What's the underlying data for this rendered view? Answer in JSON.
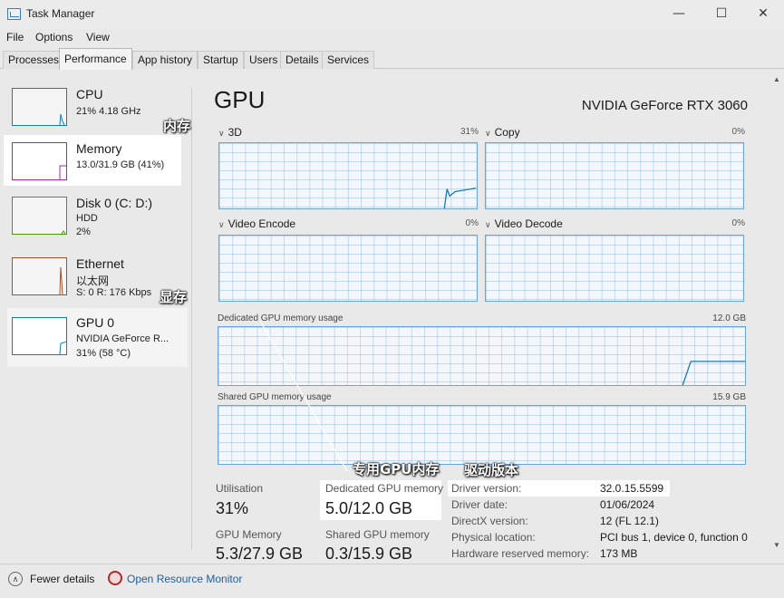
{
  "window": {
    "title": "Task Manager",
    "controls": {
      "minimize": "—",
      "maximize": "☐",
      "close": "✕"
    }
  },
  "menu": [
    "File",
    "Options",
    "View"
  ],
  "tabs": [
    "Processes",
    "Performance",
    "App history",
    "Startup",
    "Users",
    "Details",
    "Services"
  ],
  "active_tab": "Performance",
  "sidebar": {
    "items": [
      {
        "title": "CPU",
        "lines": [
          "21% 4.18 GHz"
        ],
        "color": "#1779ba",
        "icon": "cpu-graph"
      },
      {
        "title": "Memory",
        "lines": [
          "13.0/31.9 GB (41%)"
        ],
        "color": "#9b2ab0",
        "icon": "memory-graph"
      },
      {
        "title": "Disk 0 (C: D:)",
        "lines": [
          "HDD",
          "2%"
        ],
        "color": "#4e9a06",
        "icon": "disk-graph"
      },
      {
        "title": "Ethernet",
        "lines": [
          "以太网",
          "S: 0 R: 176 Kbps"
        ],
        "color": "#a0522d",
        "icon": "ethernet-graph"
      },
      {
        "title": "GPU 0",
        "lines": [
          "NVIDIA GeForce R...",
          "31% (58 °C)"
        ],
        "color": "#1779ba",
        "icon": "gpu-graph"
      }
    ]
  },
  "main": {
    "heading": "GPU",
    "model": "NVIDIA GeForce RTX 3060",
    "engines": [
      {
        "label": "3D",
        "percent": "31%"
      },
      {
        "label": "Copy",
        "percent": "0%"
      },
      {
        "label": "Video Encode",
        "percent": "0%"
      },
      {
        "label": "Video Decode",
        "percent": "0%"
      }
    ],
    "dedicated_graph": {
      "label": "Dedicated GPU memory usage",
      "max": "12.0 GB"
    },
    "shared_graph": {
      "label": "Shared GPU memory usage",
      "max": "15.9 GB"
    },
    "stats": {
      "utilisation_label": "Utilisation",
      "utilisation_value": "31%",
      "dedicated_label": "Dedicated GPU memory",
      "dedicated_value": "5.0/12.0 GB",
      "gpu_memory_label": "GPU Memory",
      "gpu_memory_value": "5.3/27.9 GB",
      "shared_label": "Shared GPU memory",
      "shared_value": "0.3/15.9 GB"
    },
    "info": [
      {
        "label": "Driver version:",
        "value": "32.0.15.5599"
      },
      {
        "label": "Driver date:",
        "value": "01/06/2024"
      },
      {
        "label": "DirectX version:",
        "value": "12 (FL 12.1)"
      },
      {
        "label": "Physical location:",
        "value": "PCI bus 1, device 0, function 0"
      },
      {
        "label": "Hardware reserved memory:",
        "value": "173 MB"
      }
    ]
  },
  "annotations": {
    "memory": "内存",
    "vram": "显存",
    "dedicated_vram": "专用GPU内存",
    "driver_version": "驱动版本"
  },
  "footer": {
    "fewer_details": "Fewer details",
    "open_monitor": "Open Resource Monitor"
  }
}
